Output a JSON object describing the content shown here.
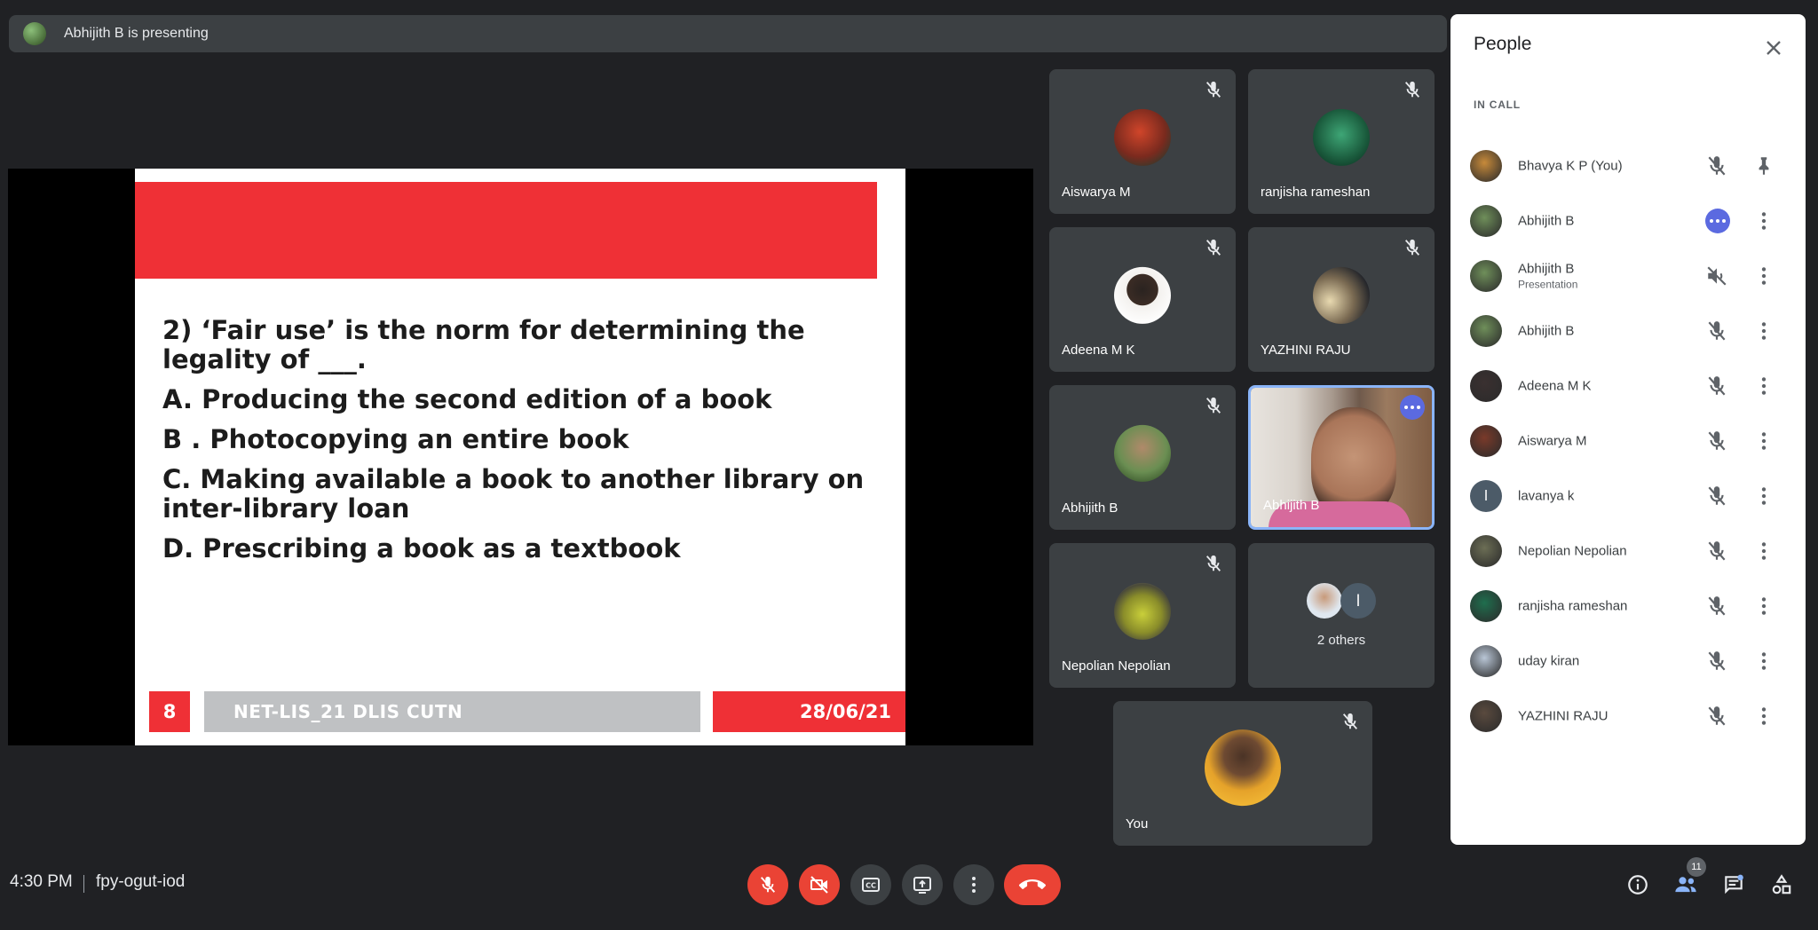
{
  "presenting_bar": {
    "text": "Abhijith B is presenting"
  },
  "slide": {
    "question": "2) ‘Fair use’ is the norm for determining the legality of ___.",
    "options": [
      "A. Producing the second edition of a book",
      "B . Photocopying an entire book",
      "C. Making available a book to another library on inter-library loan",
      "D. Prescribing a book as a textbook"
    ],
    "slide_number": "8",
    "course": "NET-LIS_21 DLIS CUTN",
    "date": "28/06/21"
  },
  "tiles": [
    {
      "name": "Aiswarya M"
    },
    {
      "name": "ranjisha rameshan"
    },
    {
      "name": "Adeena M K"
    },
    {
      "name": "YAZHINI RAJU"
    },
    {
      "name": "Abhijith B"
    },
    {
      "name": "Abhijith B"
    },
    {
      "name": "Nepolian Nepolian"
    },
    {
      "name": "2 others",
      "mini_letter": "l"
    },
    {
      "name": "You"
    }
  ],
  "people_panel": {
    "title": "People",
    "section": "IN CALL",
    "participants": [
      {
        "name": "Bhavya K P (You)",
        "sub": "",
        "mic_icon": "mic-off-icon",
        "action_icon": "pin-icon",
        "avatar_color": "#c78a3a"
      },
      {
        "name": "Abhijith B",
        "sub": "",
        "mic_icon": "speaking-dots-icon",
        "action_icon": "more-vert-icon",
        "avatar_color": "#6f8f5a"
      },
      {
        "name": "Abhijith B",
        "sub": "Presentation",
        "mic_icon": "volume-off-icon",
        "action_icon": "more-vert-icon",
        "avatar_color": "#6f8f5a"
      },
      {
        "name": "Abhijith B",
        "sub": "",
        "mic_icon": "mic-off-icon",
        "action_icon": "more-vert-icon",
        "avatar_color": "#6f8f5a"
      },
      {
        "name": "Adeena M K",
        "sub": "",
        "mic_icon": "mic-off-icon",
        "action_icon": "more-vert-icon",
        "avatar_color": "#3a3030"
      },
      {
        "name": "Aiswarya M",
        "sub": "",
        "mic_icon": "mic-off-icon",
        "action_icon": "more-vert-icon",
        "avatar_color": "#7a3a2a"
      },
      {
        "name": "lavanya k",
        "sub": "",
        "mic_icon": "mic-off-icon",
        "action_icon": "more-vert-icon",
        "avatar_color": "#4c5b68",
        "letter": "l"
      },
      {
        "name": "Nepolian Nepolian",
        "sub": "",
        "mic_icon": "mic-off-icon",
        "action_icon": "more-vert-icon",
        "avatar_color": "#6c6e55"
      },
      {
        "name": "ranjisha rameshan",
        "sub": "",
        "mic_icon": "mic-off-icon",
        "action_icon": "more-vert-icon",
        "avatar_color": "#1f6e4e"
      },
      {
        "name": "uday kiran",
        "sub": "",
        "mic_icon": "mic-off-icon",
        "action_icon": "more-vert-icon",
        "avatar_color": "#b9c6d6"
      },
      {
        "name": "YAZHINI RAJU",
        "sub": "",
        "mic_icon": "mic-off-icon",
        "action_icon": "more-vert-icon",
        "avatar_color": "#5a4a3e"
      }
    ]
  },
  "bottom_bar": {
    "time": "4:30 PM",
    "meeting_code": "fpy-ogut-iod",
    "people_count": "11"
  },
  "colors": {
    "accent_red": "#ea4335",
    "slide_red": "#ef3036",
    "active_blue": "#8ab4f8",
    "badge_blue": "#5b6ae0"
  }
}
